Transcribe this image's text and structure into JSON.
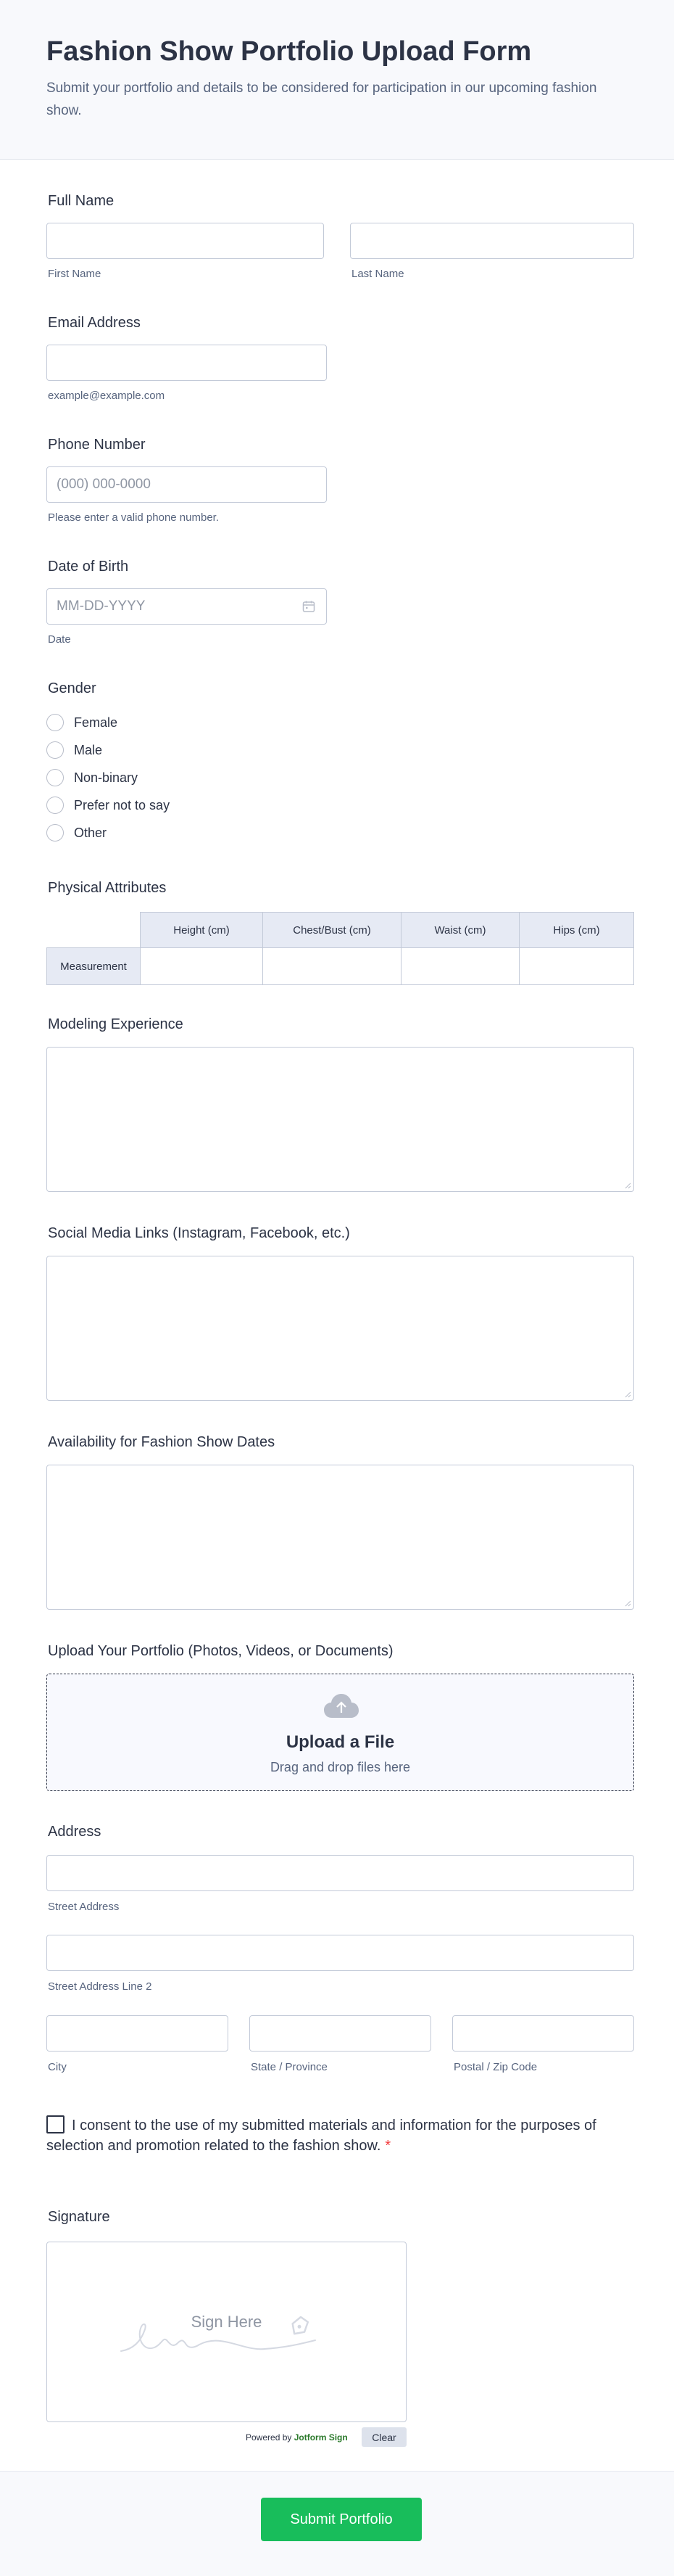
{
  "header": {
    "title": "Fashion Show Portfolio Upload Form",
    "subtitle": "Submit your portfolio and details to be considered for participation in our upcoming fashion show."
  },
  "full_name": {
    "label": "Full Name",
    "first_sublabel": "First Name",
    "last_sublabel": "Last Name"
  },
  "email": {
    "label": "Email Address",
    "sublabel": "example@example.com"
  },
  "phone": {
    "label": "Phone Number",
    "placeholder": "(000) 000-0000",
    "sublabel": "Please enter a valid phone number."
  },
  "dob": {
    "label": "Date of Birth",
    "placeholder": "MM-DD-YYYY",
    "sublabel": "Date",
    "icon": "calendar-icon"
  },
  "gender": {
    "label": "Gender",
    "options": [
      "Female",
      "Male",
      "Non-binary",
      "Prefer not to say",
      "Other"
    ]
  },
  "physical": {
    "label": "Physical Attributes",
    "columns": [
      "Height (cm)",
      "Chest/Bust (cm)",
      "Waist (cm)",
      "Hips (cm)"
    ],
    "row": "Measurement"
  },
  "experience": {
    "label": "Modeling Experience"
  },
  "social": {
    "label": "Social Media Links (Instagram, Facebook, etc.)"
  },
  "availability": {
    "label": "Availability for Fashion Show Dates"
  },
  "upload": {
    "label": "Upload Your Portfolio (Photos, Videos, or Documents)",
    "title": "Upload a File",
    "subtitle": "Drag and drop files here",
    "icon": "cloud-upload-icon"
  },
  "address": {
    "label": "Address",
    "street": "Street Address",
    "street2": "Street Address Line 2",
    "city": "City",
    "state": "State / Province",
    "zip": "Postal / Zip Code"
  },
  "consent": {
    "text": "I consent to the use of my submitted materials and information for the purposes of selection and promotion related to the fashion show.",
    "required_mark": "*"
  },
  "signature": {
    "label": "Signature",
    "placeholder": "Sign Here",
    "powered_prefix": "Powered by",
    "powered_brand": "Jotform Sign",
    "clear_label": "Clear"
  },
  "footer": {
    "submit_label": "Submit Portfolio"
  },
  "colors": {
    "submit": "#18bd5b",
    "text": "#2c3345",
    "muted": "#57647e",
    "border": "#c3cad8",
    "matrix_header": "#e6eaf4",
    "required": "#f23a3c"
  }
}
